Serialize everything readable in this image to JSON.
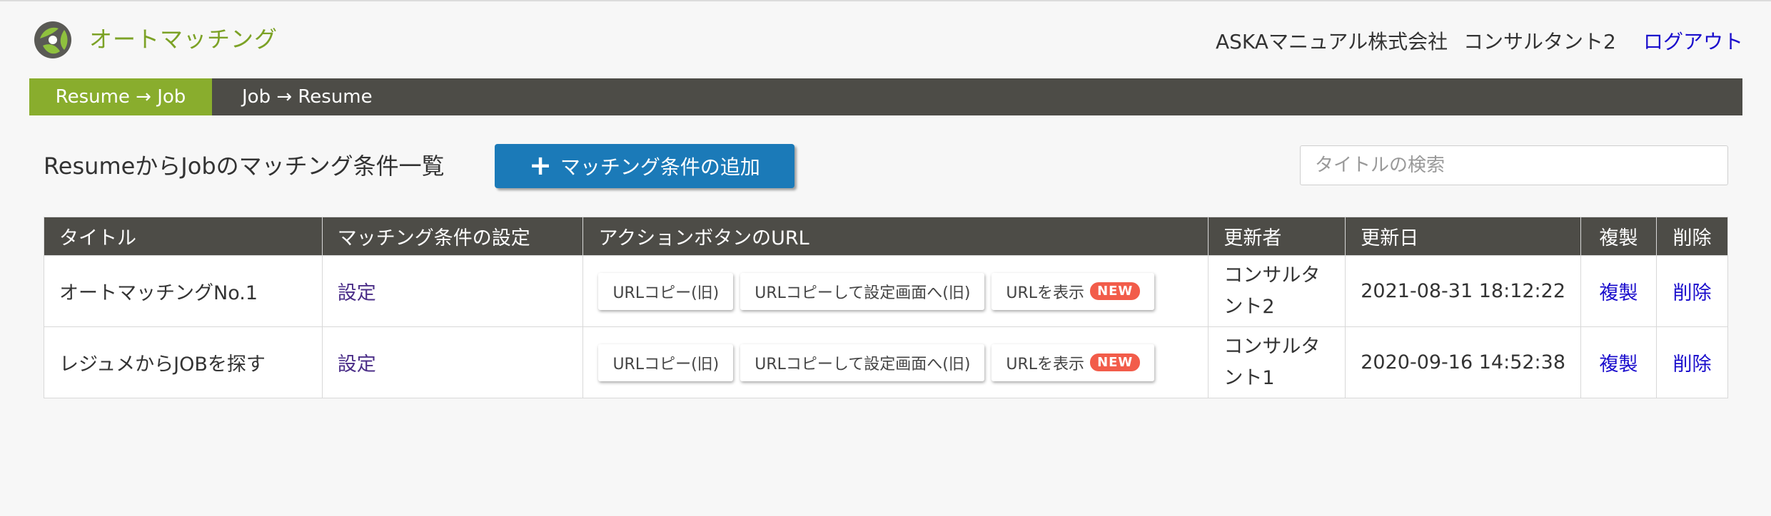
{
  "header": {
    "app_title": "オートマッチング",
    "company": "ASKAマニュアル株式会社",
    "user": "コンサルタント2",
    "logout": "ログアウト"
  },
  "nav": {
    "tabs": [
      {
        "label": "Resume → Job",
        "active": true
      },
      {
        "label": "Job → Resume",
        "active": false
      }
    ]
  },
  "toolbar": {
    "page_title": "ResumeからJobのマッチング条件一覧",
    "add_button": "マッチング条件の追加",
    "search_placeholder": "タイトルの検索"
  },
  "table": {
    "headers": [
      "タイトル",
      "マッチング条件の設定",
      "アクションボタンのURL",
      "更新者",
      "更新日",
      "複製",
      "削除"
    ],
    "action_buttons": {
      "copy_old": "URLコピー(旧)",
      "copy_setting_old": "URLコピーして設定画面へ(旧)",
      "show_url": "URLを表示",
      "new_badge": "NEW"
    },
    "rows": [
      {
        "title": "オートマッチングNo.1",
        "setting": "設定",
        "updater": "コンサルタント2",
        "updated": "2021-08-31 18:12:22",
        "duplicate": "複製",
        "delete": "削除"
      },
      {
        "title": "レジュメからJOBを探す",
        "setting": "設定",
        "updater": "コンサルタント1",
        "updated": "2020-09-16 14:52:38",
        "duplicate": "複製",
        "delete": "削除"
      }
    ]
  },
  "colors": {
    "accent_green": "#89ad2d",
    "nav_dark": "#4d4c47",
    "primary_blue": "#1b7ab8",
    "badge_red": "#f25c4a",
    "link_blue": "#1a0dcc"
  }
}
